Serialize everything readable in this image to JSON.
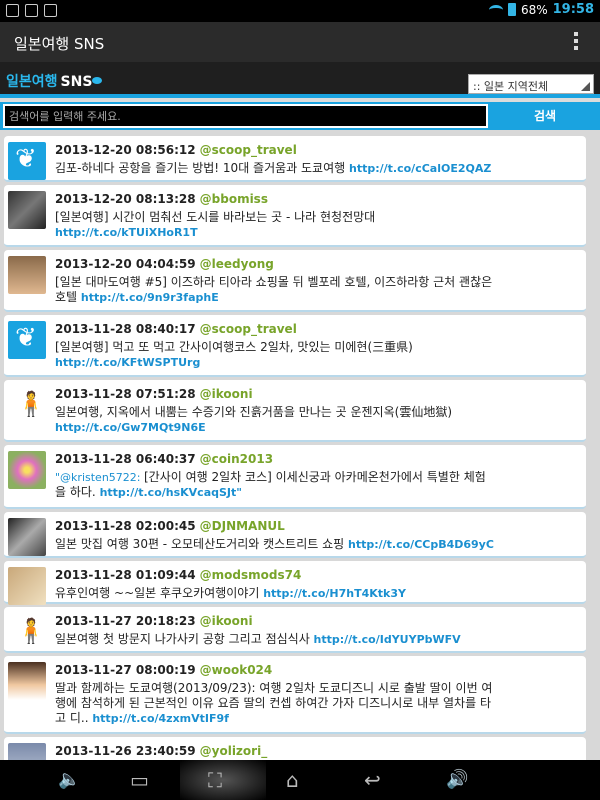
{
  "status": {
    "battery": "68%",
    "time": "19:58"
  },
  "app": {
    "title": "일본여행 SNS",
    "logo_main": "일본여행",
    "logo_sns": "SNS"
  },
  "region_select": {
    "selected": ":: 일본 지역전체"
  },
  "search": {
    "placeholder": "검색어를 입력해 주세요.",
    "button": "검색"
  },
  "tweets": [
    {
      "time": "2013-12-20 08:56:12",
      "user": "@scoop_travel",
      "text": "김포-하네다 공항을 즐기는 방법! 10대 즐거움과 도쿄여행 ",
      "link": "http://t.co/cCalOE2QAZ"
    },
    {
      "time": "2013-12-20 08:13:28",
      "user": "@bbomiss",
      "text": "[일본여행] 시간이 멈춰선 도시를 바라보는 곳 - 나라 현청전망대 ",
      "link": "http://t.co/kTUiXHoR1T"
    },
    {
      "time": "2013-12-20 04:04:59",
      "user": "@leedyong",
      "text": "[일본 대마도여행 #5] 이즈하라 티아라 쇼핑몰 뒤 벨포레 호텔, 이즈하라항 근처 괜찮은 호텔 ",
      "link": "http://t.co/9n9r3faphE"
    },
    {
      "time": "2013-11-28 08:40:17",
      "user": "@scoop_travel",
      "text": "[일본여행] 먹고 또 먹고 간사이여행코스 2일차, 맛있는 미에현(三重県) ",
      "link": "http://t.co/KFtWSPTUrg"
    },
    {
      "time": "2013-11-28 07:51:28",
      "user": "@ikooni",
      "text": "일본여행, 지옥에서 내뿜는 수증기와 진흙거품을 만나는 곳 운젠지옥(雲仙地獄) ",
      "link": "http://t.co/Gw7MQt9N6E"
    },
    {
      "time": "2013-11-28 06:40:37",
      "user": "@coin2013",
      "mention": "\"@kristen5722: ",
      "text": "[간사이 여행 2일차 코스] 이세신궁과 아카메온천가에서 특별한 체험을 하다. ",
      "link": "http://t.co/hsKVcaqSJt\""
    },
    {
      "time": "2013-11-28 02:00:45",
      "user": "@DJNMANUL",
      "text": "일본 맛집 여행 30편 - 오모테산도거리와 캣스트리트 쇼핑 ",
      "link": "http://t.co/CCpB4D69yC"
    },
    {
      "time": "2013-11-28 01:09:44",
      "user": "@modsmods74",
      "text": "유후인여행 ~~일본 후쿠오카여행이야기 ",
      "link": "http://t.co/H7hT4Ktk3Y"
    },
    {
      "time": "2013-11-27 20:18:23",
      "user": "@ikooni",
      "text": "일본여행 첫 방문지 나가사키 공항 그리고 점심식사 ",
      "link": "http://t.co/IdYUYPbWFV"
    },
    {
      "time": "2013-11-27 08:00:19",
      "user": "@wook024",
      "text": "딸과 함께하는 도쿄여행(2013/09/23): 여행 2일차 도쿄디즈니 시로 출발 딸이 이번 여행에 참석하게 된 근본적인 이유 요즘 딸의 컨셉 하여간 가자 디즈니시로 내부 열차를 타고 디.. ",
      "link": "http://t.co/4zxmVtIF9f"
    },
    {
      "time": "2013-11-26 23:40:59",
      "user": "@yolizori_",
      "text": "",
      "link": ""
    }
  ]
}
